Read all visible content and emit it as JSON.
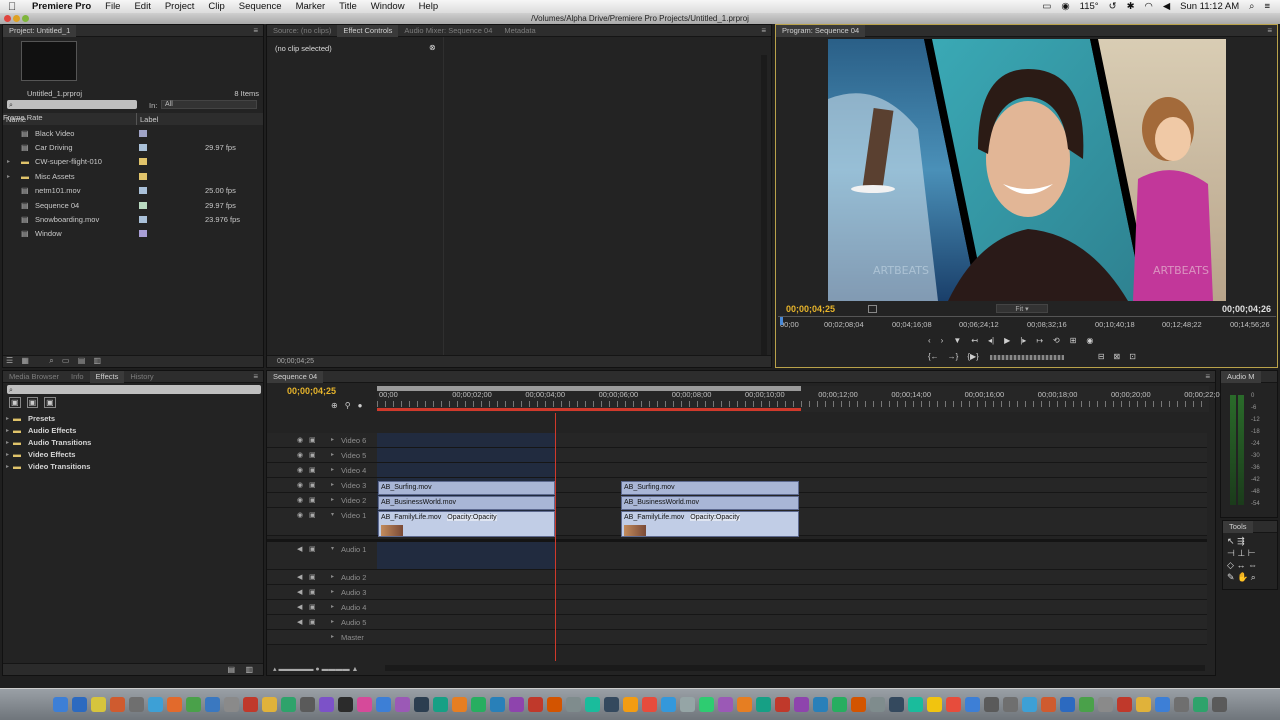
{
  "menubar": {
    "app": "Premiere Pro",
    "items": [
      "File",
      "Edit",
      "Project",
      "Clip",
      "Sequence",
      "Marker",
      "Title",
      "Window",
      "Help"
    ],
    "zoom": "115°",
    "clock": "Sun 11:12 AM"
  },
  "window": {
    "title": "/Volumes/Alpha Drive/Premiere Pro Projects/Untitled_1.prproj"
  },
  "project_panel": {
    "tab": "Project: Untitled_1",
    "project_file": "Untitled_1.prproj",
    "item_count": "8 Items",
    "in_label": "In:",
    "in_value": "All",
    "columns": [
      "Name",
      "Label",
      "Frame Rate"
    ],
    "items": [
      {
        "name": "Black Video",
        "rate": "",
        "color": "#9fa3c6",
        "folder": false
      },
      {
        "name": "Car Driving",
        "rate": "29.97 fps",
        "color": "#a9c0d8",
        "folder": false
      },
      {
        "name": "CW-super-flight-010",
        "rate": "",
        "color": "#e0c36a",
        "folder": true
      },
      {
        "name": "Misc Assets",
        "rate": "",
        "color": "#e0c36a",
        "folder": true
      },
      {
        "name": "netm101.mov",
        "rate": "25.00 fps",
        "color": "#a9c0d8",
        "folder": false
      },
      {
        "name": "Sequence 04",
        "rate": "29.97 fps",
        "color": "#b9d9c0",
        "folder": false
      },
      {
        "name": "Snowboarding.mov",
        "rate": "23.976 fps",
        "color": "#a9c0d8",
        "folder": false
      },
      {
        "name": "Window",
        "rate": "",
        "color": "#a99fd6",
        "folder": false
      }
    ]
  },
  "effect_controls": {
    "tabs": [
      "Source: (no clips)",
      "Effect Controls",
      "Audio Mixer: Sequence 04",
      "Metadata"
    ],
    "no_clip": "(no clip selected)",
    "timecode": "00;00;04;25"
  },
  "program_monitor": {
    "tab": "Program: Sequence 04",
    "timecode_current": "00;00;04;25",
    "fit": "Fit",
    "timecode_duration": "00;00;04;26",
    "ruler_labels": [
      "00;00",
      "00;02;08;04",
      "00;04;16;08",
      "00;06;24;12",
      "00;08;32;16",
      "00;10;40;18",
      "00;12;48;22",
      "00;14;56;26"
    ],
    "watermark": "ARTBEATS"
  },
  "effects_panel": {
    "tabs": [
      "Media Browser",
      "Info",
      "Effects",
      "History"
    ],
    "folders": [
      "Presets",
      "Audio Effects",
      "Audio Transitions",
      "Video Effects",
      "Video Transitions"
    ]
  },
  "timeline": {
    "tab": "Sequence 04",
    "timecode": "00;00;04;25",
    "ruler_labels": [
      "00;00",
      "00;00;02;00",
      "00;00;04;00",
      "00;00;06;00",
      "00;00;08;00",
      "00;00;10;00",
      "00;00;12;00",
      "00;00;14;00",
      "00;00;16;00",
      "00;00;18;00",
      "00;00;20;00",
      "00;00;22;00"
    ],
    "video_tracks": [
      "Video 6",
      "Video 5",
      "Video 4",
      "Video 3",
      "Video 2",
      "Video 1"
    ],
    "audio_tracks": [
      "Audio 1",
      "Audio 2",
      "Audio 3",
      "Audio 4",
      "Audio 5",
      "Master"
    ],
    "clips_a": [
      "AB_Surfing.mov",
      "AB_BusinessWorld.mov",
      "AB_FamilyLife.mov"
    ],
    "clips_b": [
      "AB_Surfing.mov",
      "AB_BusinessWorld.mov",
      "AB_FamilyLife.mov"
    ],
    "opacity_label": "Opacity:Opacity"
  },
  "audio_meter": {
    "tab": "Audio M",
    "labels": [
      "0",
      "-6",
      "-12",
      "-18",
      "-24",
      "-30",
      "-36",
      "-42",
      "-48",
      "-54"
    ]
  },
  "tools_panel": {
    "tab": "Tools"
  },
  "colors": {
    "timecode": "#e8b52b",
    "playhead": "#d0392b",
    "clip": "#a9b6d6",
    "panel": "#232323"
  }
}
